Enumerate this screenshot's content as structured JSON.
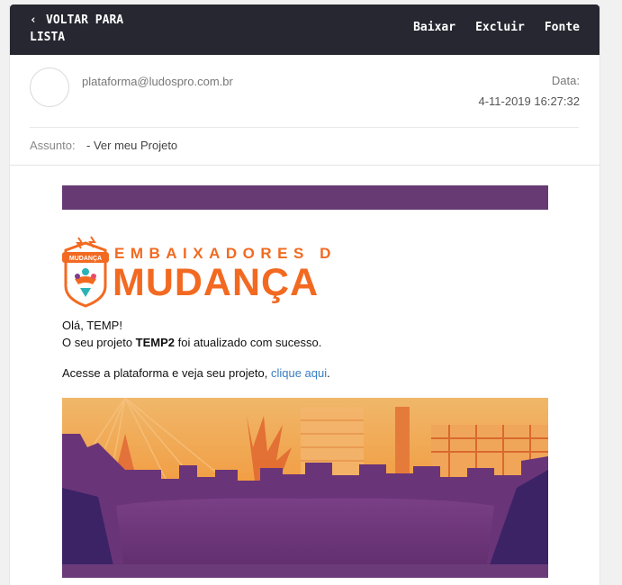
{
  "toolbar": {
    "back_line1": "VOLTAR PARA",
    "back_line2": "LISTA",
    "download": "Baixar",
    "delete": "Excluir",
    "source": "Fonte"
  },
  "message": {
    "sender": "plataforma@ludospro.com.br",
    "date_label": "Data:",
    "date_value": "4-11-2019 16:27:32",
    "subject_label": "Assunto:",
    "subject_value": "- Ver meu Projeto"
  },
  "email": {
    "logo_top": "EMBAIXADORES DA",
    "logo_bottom": "MUDANÇA",
    "badge_text": "MUDANÇA",
    "greeting": "Olá, TEMP!",
    "body_prefix": "O seu projeto ",
    "project_name": "TEMP2",
    "body_suffix": " foi atualizado com sucesso.",
    "cta_prefix": "Acesse a plataforma e veja seu projeto, ",
    "cta_link": "clique aqui",
    "cta_suffix": "."
  },
  "colors": {
    "topbar": "#262730",
    "band": "#683a74",
    "logo_orange": "#f26a21",
    "link": "#3a7ec2"
  },
  "icons": [
    "chevron-left-icon",
    "avatar-placeholder"
  ]
}
